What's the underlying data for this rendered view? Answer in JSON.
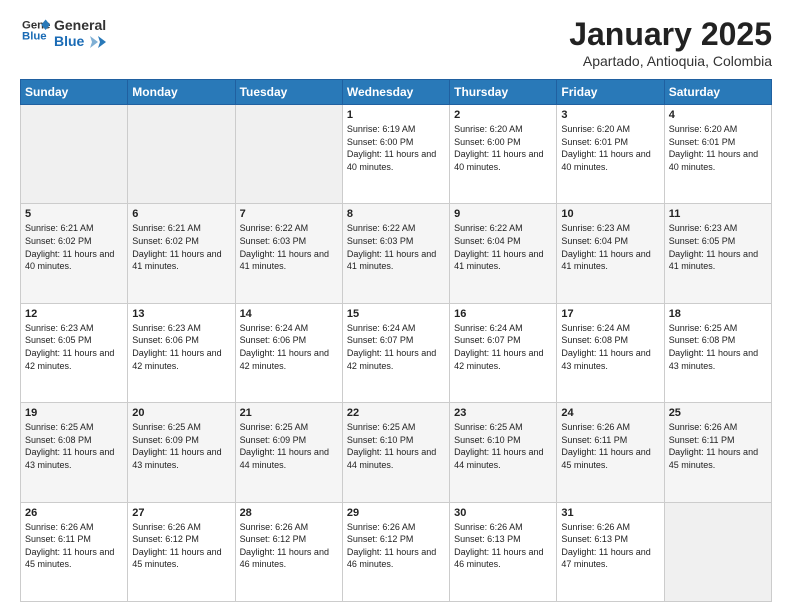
{
  "logo": {
    "line1": "General",
    "line2": "Blue"
  },
  "header": {
    "month": "January 2025",
    "location": "Apartado, Antioquia, Colombia"
  },
  "weekdays": [
    "Sunday",
    "Monday",
    "Tuesday",
    "Wednesday",
    "Thursday",
    "Friday",
    "Saturday"
  ],
  "weeks": [
    {
      "days": [
        {
          "num": "",
          "info": ""
        },
        {
          "num": "",
          "info": ""
        },
        {
          "num": "",
          "info": ""
        },
        {
          "num": "1",
          "info": "Sunrise: 6:19 AM\nSunset: 6:00 PM\nDaylight: 11 hours and 40 minutes."
        },
        {
          "num": "2",
          "info": "Sunrise: 6:20 AM\nSunset: 6:00 PM\nDaylight: 11 hours and 40 minutes."
        },
        {
          "num": "3",
          "info": "Sunrise: 6:20 AM\nSunset: 6:01 PM\nDaylight: 11 hours and 40 minutes."
        },
        {
          "num": "4",
          "info": "Sunrise: 6:20 AM\nSunset: 6:01 PM\nDaylight: 11 hours and 40 minutes."
        }
      ]
    },
    {
      "days": [
        {
          "num": "5",
          "info": "Sunrise: 6:21 AM\nSunset: 6:02 PM\nDaylight: 11 hours and 40 minutes."
        },
        {
          "num": "6",
          "info": "Sunrise: 6:21 AM\nSunset: 6:02 PM\nDaylight: 11 hours and 41 minutes."
        },
        {
          "num": "7",
          "info": "Sunrise: 6:22 AM\nSunset: 6:03 PM\nDaylight: 11 hours and 41 minutes."
        },
        {
          "num": "8",
          "info": "Sunrise: 6:22 AM\nSunset: 6:03 PM\nDaylight: 11 hours and 41 minutes."
        },
        {
          "num": "9",
          "info": "Sunrise: 6:22 AM\nSunset: 6:04 PM\nDaylight: 11 hours and 41 minutes."
        },
        {
          "num": "10",
          "info": "Sunrise: 6:23 AM\nSunset: 6:04 PM\nDaylight: 11 hours and 41 minutes."
        },
        {
          "num": "11",
          "info": "Sunrise: 6:23 AM\nSunset: 6:05 PM\nDaylight: 11 hours and 41 minutes."
        }
      ]
    },
    {
      "days": [
        {
          "num": "12",
          "info": "Sunrise: 6:23 AM\nSunset: 6:05 PM\nDaylight: 11 hours and 42 minutes."
        },
        {
          "num": "13",
          "info": "Sunrise: 6:23 AM\nSunset: 6:06 PM\nDaylight: 11 hours and 42 minutes."
        },
        {
          "num": "14",
          "info": "Sunrise: 6:24 AM\nSunset: 6:06 PM\nDaylight: 11 hours and 42 minutes."
        },
        {
          "num": "15",
          "info": "Sunrise: 6:24 AM\nSunset: 6:07 PM\nDaylight: 11 hours and 42 minutes."
        },
        {
          "num": "16",
          "info": "Sunrise: 6:24 AM\nSunset: 6:07 PM\nDaylight: 11 hours and 42 minutes."
        },
        {
          "num": "17",
          "info": "Sunrise: 6:24 AM\nSunset: 6:08 PM\nDaylight: 11 hours and 43 minutes."
        },
        {
          "num": "18",
          "info": "Sunrise: 6:25 AM\nSunset: 6:08 PM\nDaylight: 11 hours and 43 minutes."
        }
      ]
    },
    {
      "days": [
        {
          "num": "19",
          "info": "Sunrise: 6:25 AM\nSunset: 6:08 PM\nDaylight: 11 hours and 43 minutes."
        },
        {
          "num": "20",
          "info": "Sunrise: 6:25 AM\nSunset: 6:09 PM\nDaylight: 11 hours and 43 minutes."
        },
        {
          "num": "21",
          "info": "Sunrise: 6:25 AM\nSunset: 6:09 PM\nDaylight: 11 hours and 44 minutes."
        },
        {
          "num": "22",
          "info": "Sunrise: 6:25 AM\nSunset: 6:10 PM\nDaylight: 11 hours and 44 minutes."
        },
        {
          "num": "23",
          "info": "Sunrise: 6:25 AM\nSunset: 6:10 PM\nDaylight: 11 hours and 44 minutes."
        },
        {
          "num": "24",
          "info": "Sunrise: 6:26 AM\nSunset: 6:11 PM\nDaylight: 11 hours and 45 minutes."
        },
        {
          "num": "25",
          "info": "Sunrise: 6:26 AM\nSunset: 6:11 PM\nDaylight: 11 hours and 45 minutes."
        }
      ]
    },
    {
      "days": [
        {
          "num": "26",
          "info": "Sunrise: 6:26 AM\nSunset: 6:11 PM\nDaylight: 11 hours and 45 minutes."
        },
        {
          "num": "27",
          "info": "Sunrise: 6:26 AM\nSunset: 6:12 PM\nDaylight: 11 hours and 45 minutes."
        },
        {
          "num": "28",
          "info": "Sunrise: 6:26 AM\nSunset: 6:12 PM\nDaylight: 11 hours and 46 minutes."
        },
        {
          "num": "29",
          "info": "Sunrise: 6:26 AM\nSunset: 6:12 PM\nDaylight: 11 hours and 46 minutes."
        },
        {
          "num": "30",
          "info": "Sunrise: 6:26 AM\nSunset: 6:13 PM\nDaylight: 11 hours and 46 minutes."
        },
        {
          "num": "31",
          "info": "Sunrise: 6:26 AM\nSunset: 6:13 PM\nDaylight: 11 hours and 47 minutes."
        },
        {
          "num": "",
          "info": ""
        }
      ]
    }
  ]
}
